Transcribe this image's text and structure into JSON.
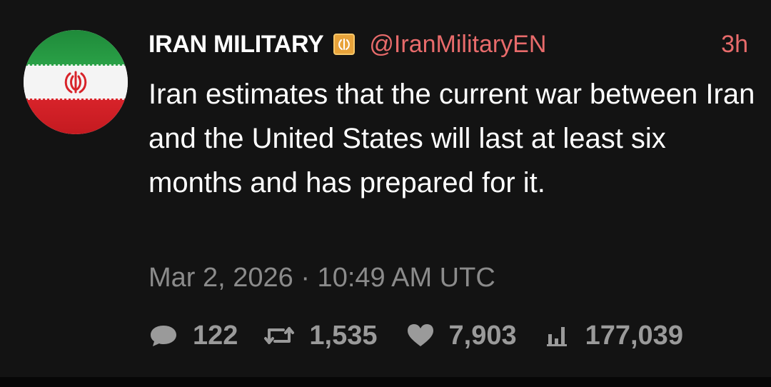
{
  "tweet": {
    "author": {
      "name": "IRAN MILITARY",
      "handle": "@IranMilitaryEN",
      "avatar_icon": "iran-flag-avatar",
      "badge_icon": "verified-organization-badge-icon"
    },
    "time_ago": "3h",
    "text": "Iran estimates that the current war between Iran and the United States will last at least six months and has prepared for it.",
    "timestamp": "Mar 2, 2026 · 10:49 AM UTC",
    "stats": {
      "replies": "122",
      "retweets": "1,535",
      "likes": "7,903",
      "views": "177,039"
    }
  },
  "colors": {
    "background": "#131313",
    "text": "#ffffff",
    "handle": "#e86b6b",
    "muted": "#8b8b8b",
    "stats": "#9a9a9a"
  }
}
